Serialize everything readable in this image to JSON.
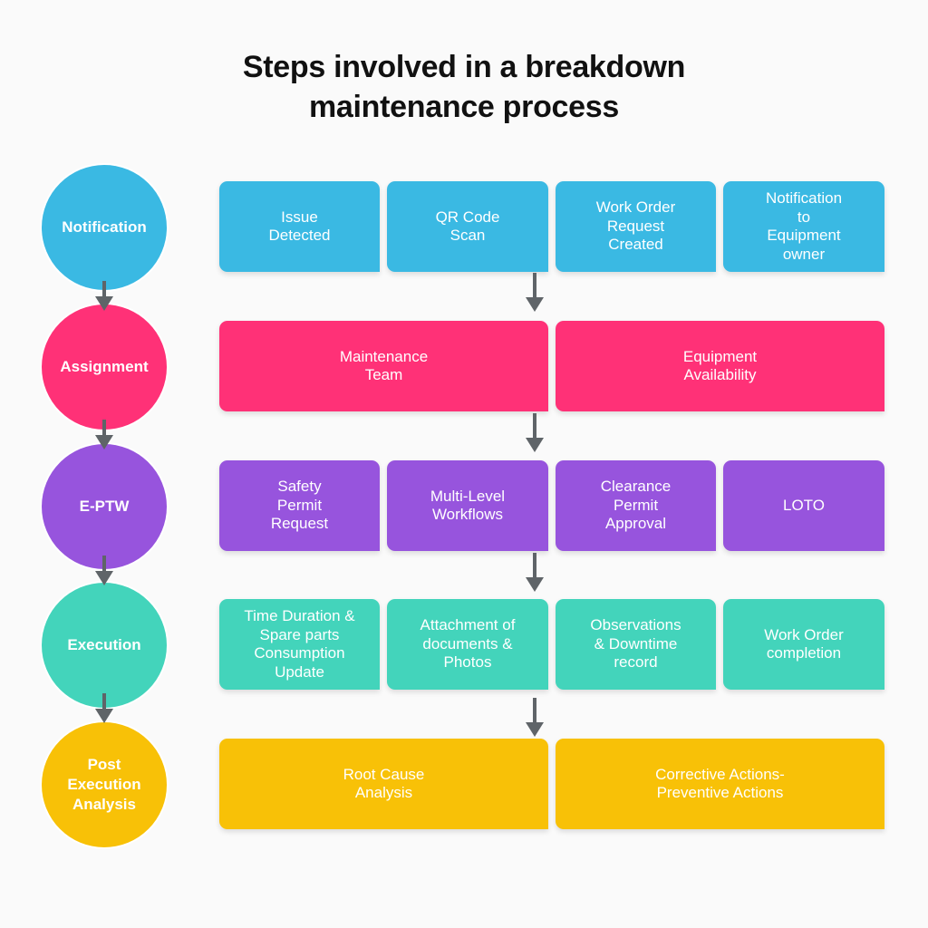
{
  "title": {
    "line1": "Steps involved in a breakdown",
    "line2": "maintenance process"
  },
  "colors": {
    "notification": "#3ab9e3",
    "assignment": "#ff3177",
    "eptw": "#9754dd",
    "execution": "#43d4bb",
    "post_execution": "#f8c107",
    "arrow": "#5f6468"
  },
  "stages": [
    {
      "label": "Notification",
      "steps": [
        "Issue\nDetected",
        "QR Code\nScan",
        "Work Order\nRequest\nCreated",
        "Notification\nto\nEquipment\nowner"
      ]
    },
    {
      "label": "Assignment",
      "steps": [
        "Maintenance\nTeam",
        "Equipment\nAvailability"
      ]
    },
    {
      "label": "E-PTW",
      "steps": [
        "Safety\nPermit\nRequest",
        "Multi-Level\nWorkflows",
        "Clearance\nPermit\nApproval",
        "LOTO"
      ]
    },
    {
      "label": "Execution",
      "steps": [
        "Time Duration &\nSpare parts\nConsumption\nUpdate",
        "Attachment of\ndocuments &\nPhotos",
        "Observations\n& Downtime\nrecord",
        "Work Order\ncompletion"
      ]
    },
    {
      "label": "Post\nExecution\nAnalysis",
      "steps": [
        "Root Cause\nAnalysis",
        "Corrective Actions-\nPreventive Actions"
      ]
    }
  ]
}
